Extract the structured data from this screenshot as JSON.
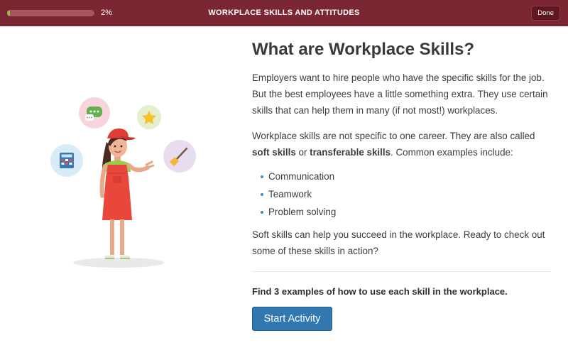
{
  "header": {
    "title": "WORKPLACE SKILLS AND ATTITUDES",
    "progress_text": "2%",
    "progress_value": 0.02,
    "done_label": "Done"
  },
  "main": {
    "heading": "What are Workplace Skills?",
    "paragraph1": "Employers want to hire people who have the specific skills for the job. But the best employees have a little something extra. They use certain skills that can help them in many (if not most!) workplaces.",
    "paragraph2_pre": "Workplace skills are not specific to one career. They are also called ",
    "paragraph2_bold1": "soft skills",
    "paragraph2_mid": " or ",
    "paragraph2_bold2": "transferable skills",
    "paragraph2_post": ". Common examples include:",
    "skills": [
      "Communication",
      "Teamwork",
      "Problem solving"
    ],
    "paragraph3": "Soft skills can help you succeed in the workplace. Ready to check out some of these skills in action?",
    "cta_text": "Find 3 examples of how to use each skill in the workplace.",
    "start_label": "Start Activity"
  },
  "illustration": {
    "icons": [
      "chat-bubble-icon",
      "star-icon",
      "calculator-icon",
      "broom-icon"
    ]
  },
  "colors": {
    "header_bg": "#7a2633",
    "progress_fill": "#8cc63f",
    "accent_button": "#3178b1",
    "bullet": "#3a8fc7"
  }
}
